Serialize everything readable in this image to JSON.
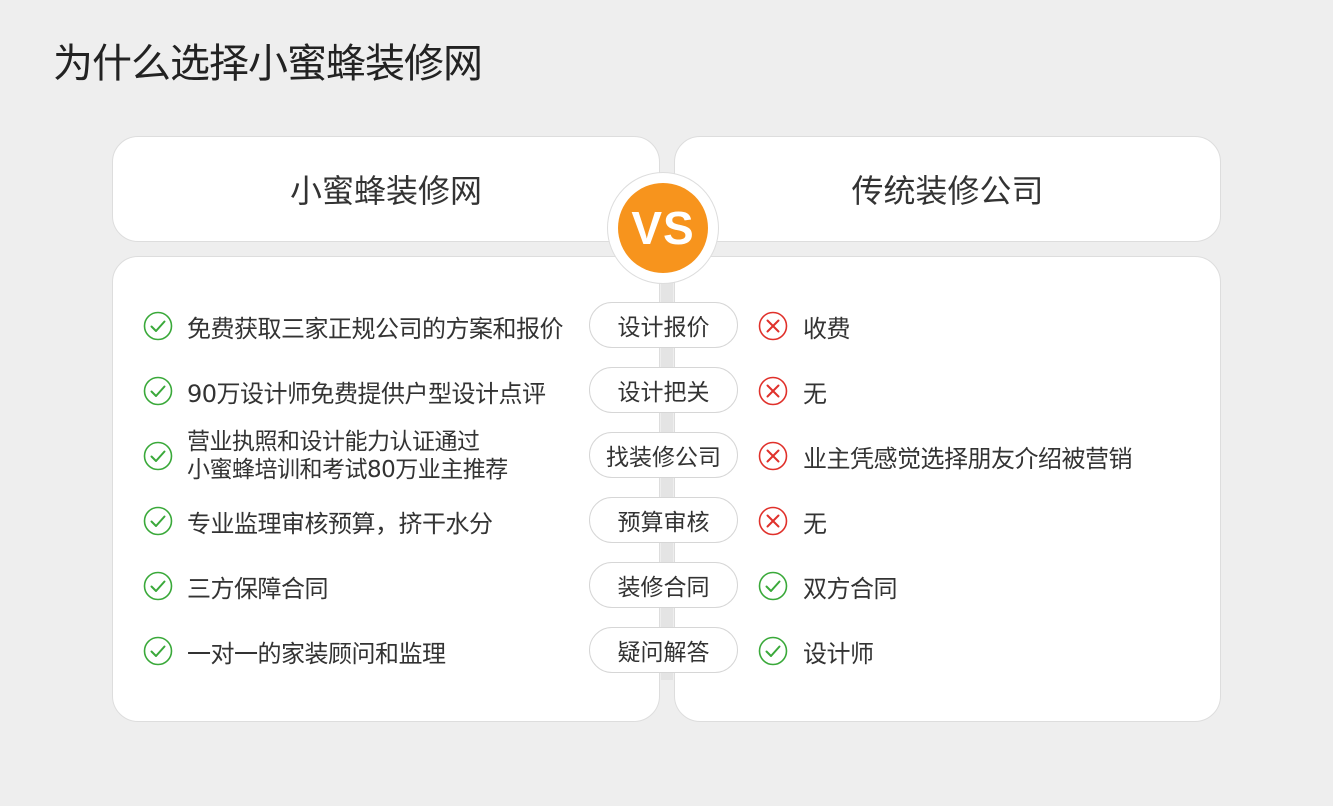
{
  "page": {
    "title": "为什么选择小蜜蜂装修网"
  },
  "colors": {
    "accent": "#f7941d",
    "check": "#3aa93a",
    "cross": "#e0312b"
  },
  "header": {
    "left_title": "小蜜蜂装修网",
    "vs_label": "VS",
    "right_title": "传统装修公司"
  },
  "rows": [
    {
      "left_icon": "check-icon",
      "left_text": "免费获取三家正规公司的方案和报价",
      "topic": "设计报价",
      "right_icon": "cross-icon",
      "right_text": "收费"
    },
    {
      "left_icon": "check-icon",
      "left_text": "90万设计师免费提供户型设计点评",
      "topic": "设计把关",
      "right_icon": "cross-icon",
      "right_text": "无"
    },
    {
      "left_icon": "check-icon",
      "left_text_line1": "营业执照和设计能力认证通过",
      "left_text_line2": "小蜜蜂培训和考试80万业主推荐",
      "topic": "找装修公司",
      "right_icon": "cross-icon",
      "right_text": "业主凭感觉选择朋友介绍被营销"
    },
    {
      "left_icon": "check-icon",
      "left_text": "专业监理审核预算，挤干水分",
      "topic": "预算审核",
      "right_icon": "cross-icon",
      "right_text": "无"
    },
    {
      "left_icon": "check-icon",
      "left_text": "三方保障合同",
      "topic": "装修合同",
      "right_icon": "check-icon",
      "right_text": "双方合同"
    },
    {
      "left_icon": "check-icon",
      "left_text": "一对一的家装顾问和监理",
      "topic": "疑问解答",
      "right_icon": "check-icon",
      "right_text": "设计师"
    }
  ]
}
